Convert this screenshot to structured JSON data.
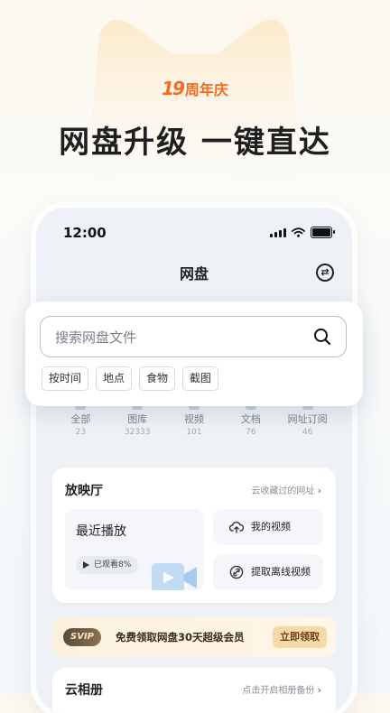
{
  "promo": {
    "badge_number": "19",
    "badge_text": "周年庆",
    "headline": "网盘升级 一键直达"
  },
  "status_bar": {
    "time": "12:00"
  },
  "nav": {
    "title": "网盘"
  },
  "search": {
    "placeholder": "搜索网盘文件",
    "tags": [
      "按时间",
      "地点",
      "食物",
      "截图"
    ]
  },
  "categories": [
    {
      "label": "全部",
      "count": "23"
    },
    {
      "label": "图库",
      "count": "32333"
    },
    {
      "label": "视频",
      "count": "101"
    },
    {
      "label": "文档",
      "count": "76"
    },
    {
      "label": "网址订阅",
      "count": "46"
    }
  ],
  "theater": {
    "title": "放映厅",
    "link": "云收藏过的网址",
    "recent_title": "最近播放",
    "watched": "已观看8%",
    "my_videos": "我的视频",
    "offline": "提取离线视频"
  },
  "vip": {
    "badge": "SVIP",
    "text": "免费领取网盘30天超级会员",
    "button": "立即领取"
  },
  "album": {
    "title": "云相册",
    "link": "点击开启相册备份"
  },
  "colors": {
    "accent_orange": "#f26a24",
    "vip_gold": "#f6d9a8"
  }
}
